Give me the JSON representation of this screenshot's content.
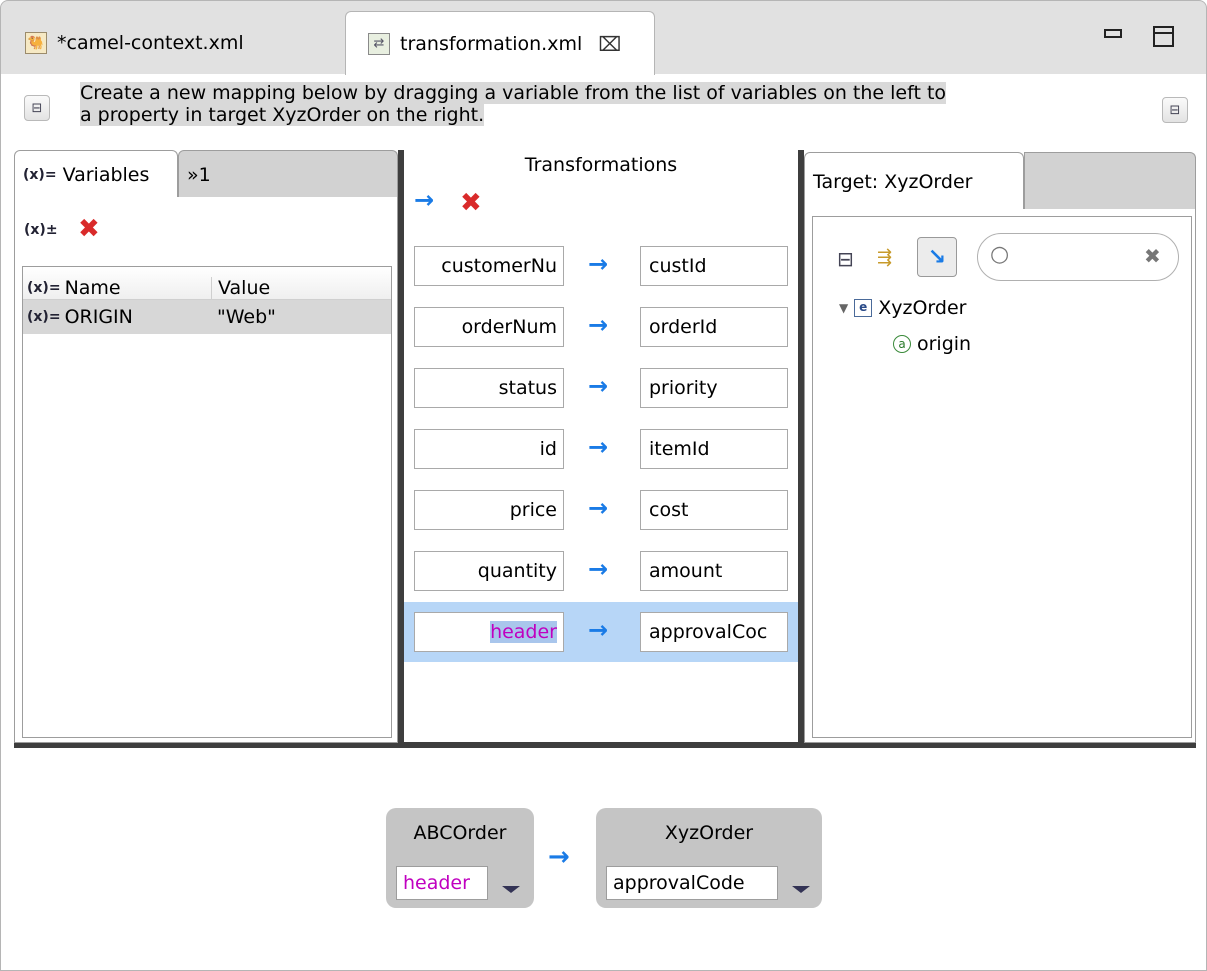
{
  "editor_tabs": [
    {
      "label": "*camel-context.xml",
      "icon": "camel-file-icon"
    },
    {
      "label": "transformation.xml",
      "icon": "transformation-file-icon",
      "close_glyph": "⌧"
    }
  ],
  "help_text_line1": "Create a new mapping below by dragging a variable from the list of variables on the left to",
  "help_text_line2": "a property in target XyzOrder on the right.",
  "variables_panel": {
    "tab_label": "Variables",
    "overflow_label": "»1",
    "columns": [
      "Name",
      "Value"
    ],
    "rows": [
      {
        "name": "ORIGIN",
        "value": "\"Web\""
      }
    ]
  },
  "transformations_panel": {
    "title": "Transformations",
    "mappings": [
      {
        "source": "customerNu",
        "target": "custId"
      },
      {
        "source": "orderNum",
        "target": "orderId"
      },
      {
        "source": "status",
        "target": "priority"
      },
      {
        "source": "id",
        "target": "itemId"
      },
      {
        "source": "price",
        "target": "cost"
      },
      {
        "source": "quantity",
        "target": "amount"
      },
      {
        "source": "header",
        "target": "approvalCoc"
      }
    ],
    "selected_index": 6
  },
  "target_panel": {
    "tab_label": "Target: XyzOrder",
    "tree_root": "XyzOrder",
    "tree_children": [
      "origin"
    ]
  },
  "detail": {
    "source_type": "ABCOrder",
    "source_field": "header",
    "target_type": "XyzOrder",
    "target_field": "approvalCode"
  },
  "colors": {
    "arrow": "#1a7be6",
    "variable_text": "#c000c0",
    "selected_row": "#b7d6f7"
  }
}
